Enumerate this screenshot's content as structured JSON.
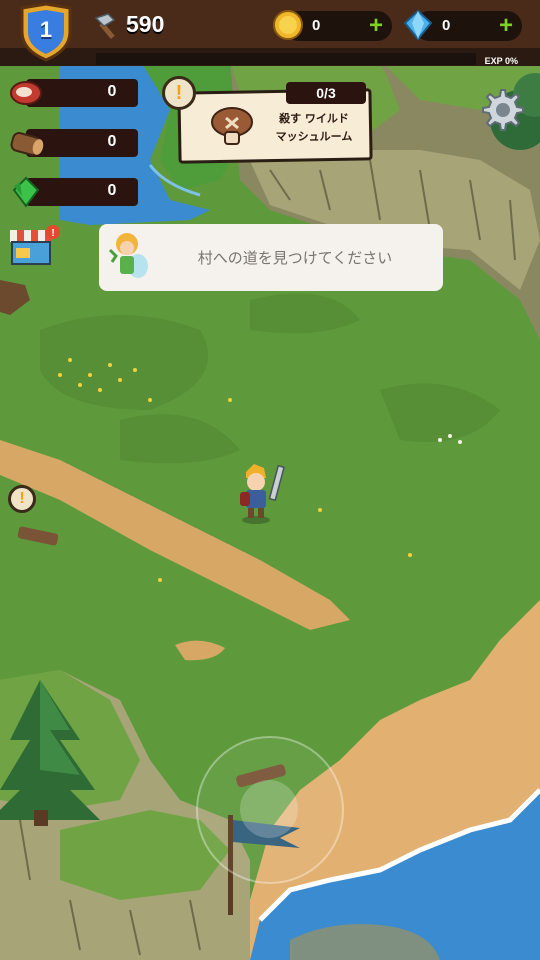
{
  "hud": {
    "level": "1",
    "hammer_count": "590",
    "gold": "0",
    "gems": "0",
    "gold_add": "+",
    "gems_add": "+",
    "exp_label": "EXP 0%",
    "exp_fraction": 0
  },
  "resources": [
    {
      "name": "meat",
      "value": "0"
    },
    {
      "name": "wood",
      "value": "0"
    },
    {
      "name": "crystal",
      "value": "0"
    }
  ],
  "quest": {
    "alert": "!",
    "progress": "0/3",
    "line1": "殺す ワイルド",
    "line2": "マッシュルーム"
  },
  "dialog": {
    "text": "村への道を見つけてください"
  },
  "side_alert": "!",
  "icons": {
    "shield": "level-shield-icon",
    "hammer": "hammer-icon",
    "coin": "gold-coin-icon",
    "gem": "blue-gem-icon",
    "settings": "gear-icon",
    "shop": "shop-stall-icon"
  },
  "colors": {
    "grass": "#5e9a3c",
    "path": "#d6a765",
    "sand": "#e2b070",
    "water": "#3a8bd0",
    "topbar": "#4a2a18",
    "plus": "#7ed321",
    "alert": "#f2a11a"
  }
}
